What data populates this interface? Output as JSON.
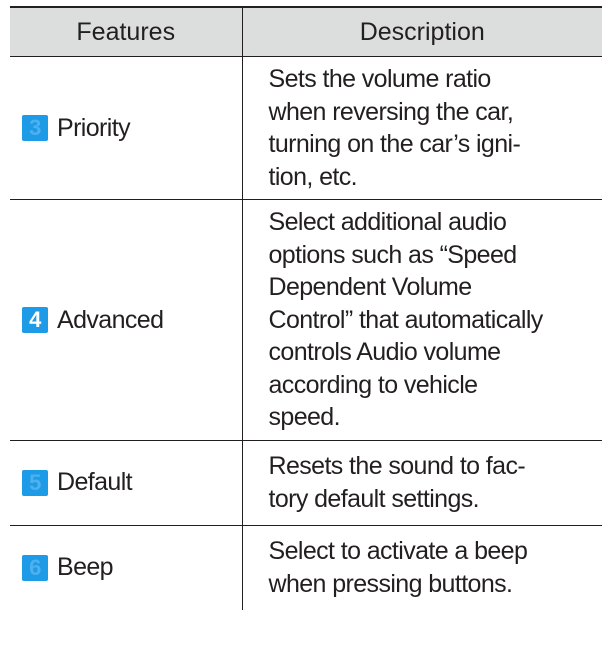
{
  "table": {
    "headers": [
      "Features",
      "Description"
    ],
    "rows": [
      {
        "badge": "3",
        "feature": "Priority",
        "description": [
          "Sets the volume ratio",
          "when reversing the car,",
          "turning on the car’s igni-",
          "tion, etc."
        ]
      },
      {
        "badge": "4",
        "feature": "Advanced",
        "description": [
          "Select additional audio",
          "options such as “Speed",
          "Dependent Volume",
          "Control” that automatically",
          "controls Audio volume",
          "according to vehicle",
          "speed."
        ]
      },
      {
        "badge": "5",
        "feature": "Default",
        "description": [
          "Resets the sound to fac-",
          "tory default settings."
        ]
      },
      {
        "badge": "6",
        "feature": "Beep",
        "description": [
          "Select to activate a beep",
          "when pressing buttons."
        ]
      }
    ]
  },
  "colors": {
    "badge": "#1e9be6",
    "header_bg": "#dcdddd",
    "text": "#231f20"
  }
}
